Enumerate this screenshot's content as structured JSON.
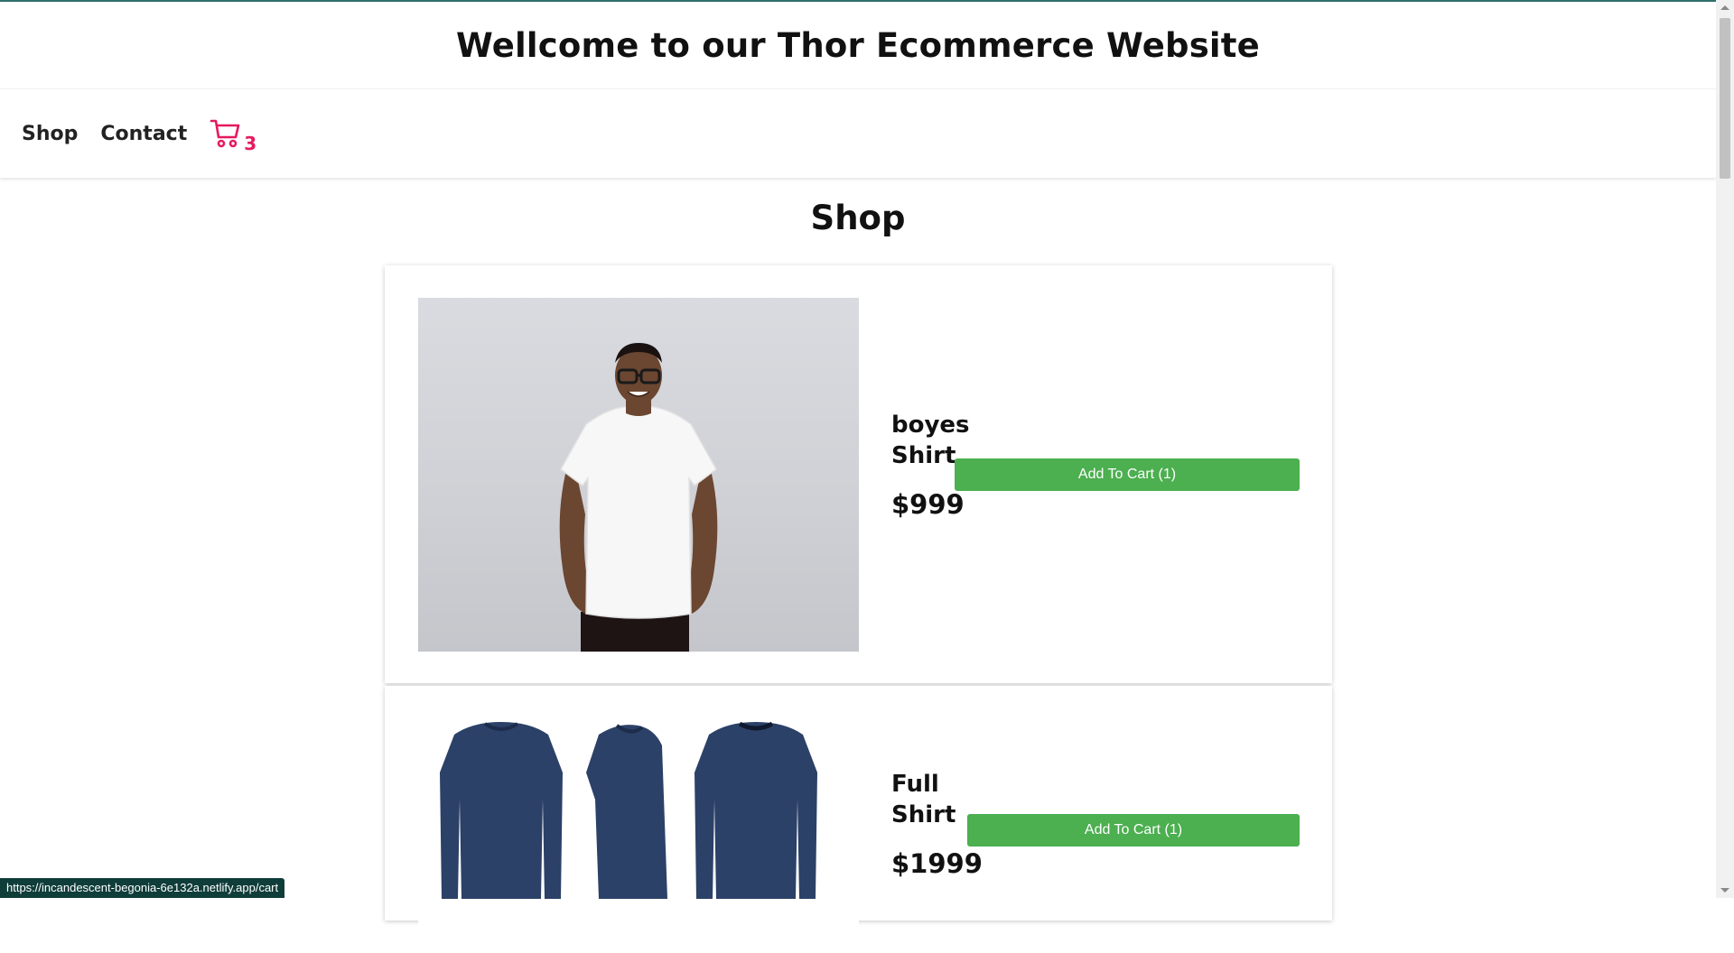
{
  "header": {
    "title": "Wellcome to our Thor Ecommerce Website"
  },
  "nav": {
    "shop_label": "Shop",
    "contact_label": "Contact",
    "cart_icon": "cart-icon",
    "cart_count": "3",
    "cart_color": "#e5195e"
  },
  "page": {
    "title": "Shop"
  },
  "products": [
    {
      "name": "boyes Shirt",
      "price": "$999",
      "button_label": "Add To Cart (1)",
      "image": "model wearing white t-shirt"
    },
    {
      "name": "Full Shirt",
      "price": "$1999",
      "button_label": "Add To Cart (1)",
      "image": "navy long-sleeve shirt front, side and back views"
    }
  ],
  "colors": {
    "button": "#4caf50",
    "accent": "#e5195e"
  },
  "status_bar": {
    "url": "https://incandescent-begonia-6e132a.netlify.app/cart"
  }
}
